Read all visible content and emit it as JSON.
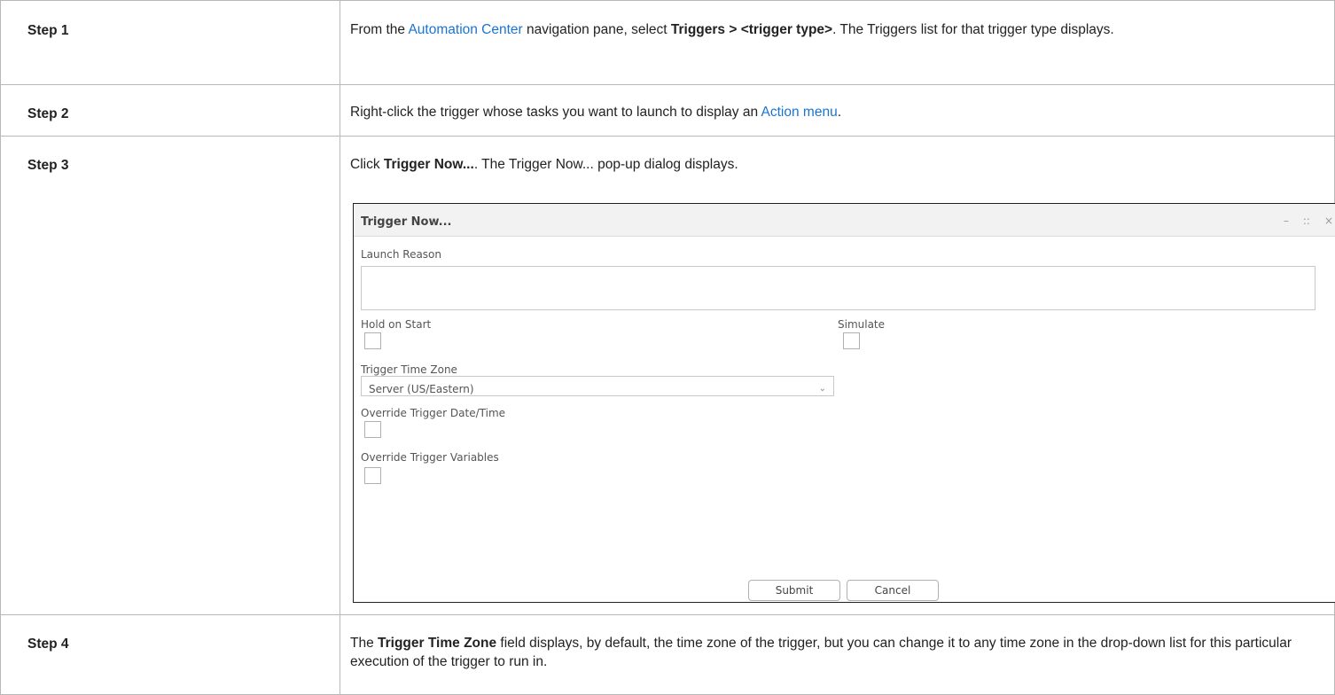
{
  "steps": [
    {
      "label": "Step 1",
      "text": {
        "pre": "From the ",
        "link": "Automation Center",
        "mid": " navigation pane, select ",
        "bold": "Triggers > <trigger type>",
        "post": ". The Triggers list for that trigger type displays."
      }
    },
    {
      "label": "Step 2",
      "text": {
        "pre": "Right-click the trigger whose tasks you want to launch to display an ",
        "link": "Action menu",
        "post": "."
      }
    },
    {
      "label": "Step 3",
      "text": {
        "pre": "Click ",
        "bold": "Trigger Now...",
        "post": ". The Trigger Now... pop-up dialog displays."
      }
    },
    {
      "label": "Step 4",
      "text": {
        "pre": "The ",
        "bold": "Trigger Time Zone",
        "post": " field displays, by default, the time zone of the trigger, but you can change it to any time zone in the drop-down list for this particular execution of the trigger to run in."
      }
    }
  ],
  "dialog": {
    "title": "Trigger Now...",
    "controls": {
      "minimize": "–",
      "maximize": "::",
      "close": "×"
    },
    "launch_reason_label": "Launch Reason",
    "launch_reason_value": "",
    "hold_on_start_label": "Hold on Start",
    "hold_on_start_checked": false,
    "simulate_label": "Simulate",
    "simulate_checked": false,
    "time_zone_label": "Trigger Time Zone",
    "time_zone_value": "Server (US/Eastern)",
    "override_datetime_label": "Override Trigger Date/Time",
    "override_datetime_checked": false,
    "override_vars_label": "Override Trigger Variables",
    "override_vars_checked": false,
    "submit_label": "Submit",
    "cancel_label": "Cancel"
  }
}
